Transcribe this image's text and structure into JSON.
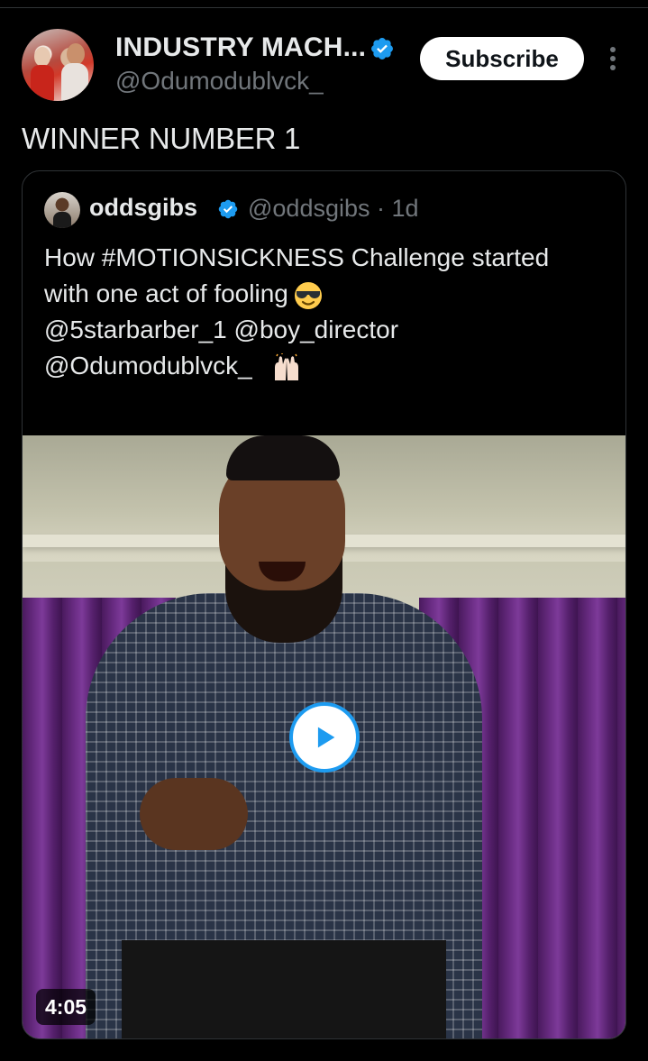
{
  "author": {
    "display_name": "INDUSTRY MACH...",
    "handle": "@Odumodublvck_",
    "verified": true
  },
  "actions": {
    "subscribe_label": "Subscribe",
    "more_icon": "more-vertical-icon"
  },
  "tweet": {
    "text": "WINNER NUMBER 1"
  },
  "quote": {
    "author_name": "oddsgibs",
    "author_handle": "@oddsgibs",
    "separator": "·",
    "time": "1d",
    "verified": true,
    "lines": [
      "How #MOTIONSICKNESS Challenge started",
      "with one act of fooling"
    ],
    "mentions_line1": "@5starbarber_1  @boy_director",
    "mentions_line2": "@Odumodublvck_",
    "emoji_1": "smiling-face-with-sunglasses-emoji",
    "emoji_2": "raising-hands-emoji"
  },
  "video": {
    "duration": "4:05",
    "play_icon": "play-icon"
  },
  "colors": {
    "background": "#000000",
    "verified_blue": "#1d9bf0",
    "secondary_text": "#71767b",
    "primary_text": "#e7e9ea"
  }
}
